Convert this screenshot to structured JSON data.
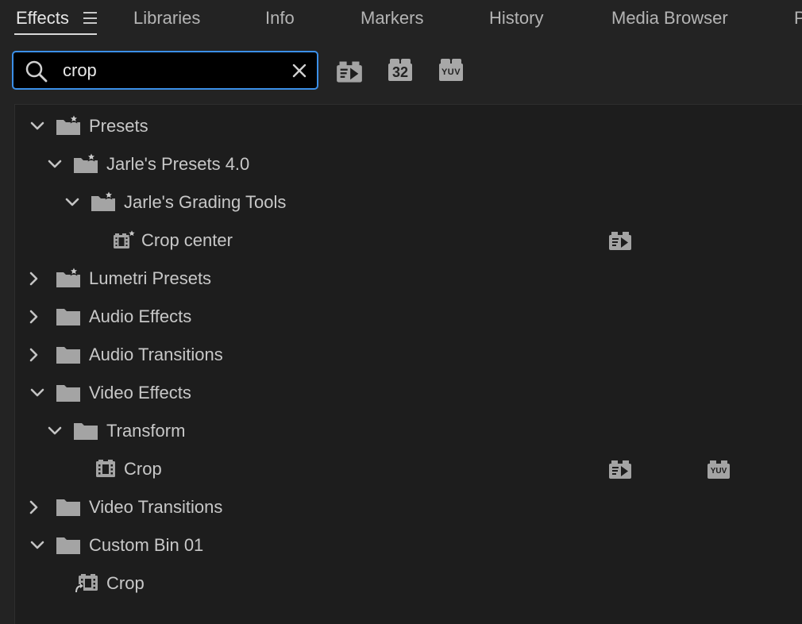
{
  "tabs": [
    {
      "label": "Effects",
      "active": true
    },
    {
      "label": "Libraries"
    },
    {
      "label": "Info"
    },
    {
      "label": "Markers"
    },
    {
      "label": "History"
    },
    {
      "label": "Media Browser"
    },
    {
      "label": "P"
    }
  ],
  "search": {
    "value": "crop"
  },
  "filters": {
    "badge_32": "32",
    "badge_yuv": "YUV"
  },
  "tree": {
    "presets": "Presets",
    "jarles_presets": "Jarle's Presets 4.0",
    "jarles_grading": "Jarle's Grading Tools",
    "crop_center": "Crop center",
    "lumetri_presets": "Lumetri Presets",
    "audio_effects": "Audio Effects",
    "audio_transitions": "Audio Transitions",
    "video_effects": "Video Effects",
    "transform": "Transform",
    "crop": "Crop",
    "video_transitions": "Video Transitions",
    "custom_bin": "Custom Bin 01",
    "custom_crop": "Crop"
  },
  "colors": {
    "accent": "#3b8fe8",
    "background": "#232323",
    "panel": "#1d1d1d",
    "icon": "#a8a8a8"
  }
}
